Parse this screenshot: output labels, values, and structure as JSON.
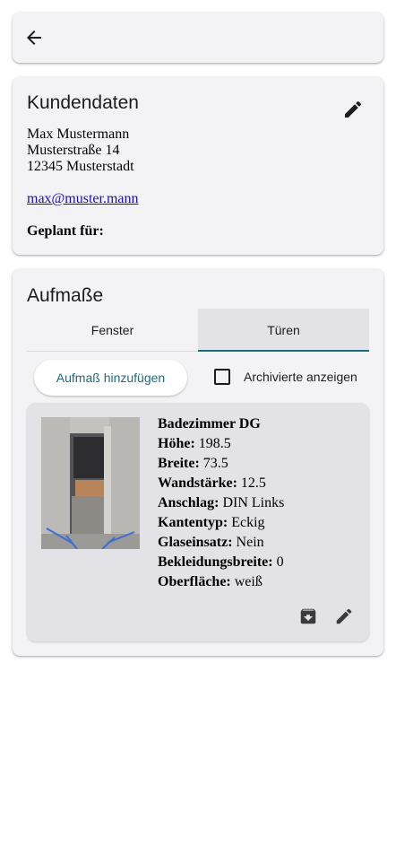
{
  "customer": {
    "title": "Kundendaten",
    "name": "Max Mustermann",
    "street": "Musterstraße 14",
    "city": "12345 Musterstadt",
    "email": "max@muster.mann",
    "planned_label": "Geplant für:"
  },
  "measures": {
    "title": "Aufmaße",
    "tabs": [
      {
        "label": "Fenster",
        "active": false
      },
      {
        "label": "Türen",
        "active": true
      }
    ],
    "add_button": "Aufmaß hinzufügen",
    "show_archived_label": "Archivierte anzeigen",
    "show_archived_checked": false,
    "items": [
      {
        "title": "Badezimmer DG",
        "fields": [
          {
            "label": "Höhe:",
            "value": "198.5"
          },
          {
            "label": "Breite:",
            "value": "73.5"
          },
          {
            "label": "Wandstärke:",
            "value": "12.5"
          },
          {
            "label": "Anschlag:",
            "value": "DIN Links"
          },
          {
            "label": "Kantentyp:",
            "value": "Eckig"
          },
          {
            "label": "Glaseinsatz:",
            "value": "Nein"
          },
          {
            "label": "Bekleidungsbreite:",
            "value": "0"
          },
          {
            "label": "Oberfläche:",
            "value": "weiß"
          }
        ]
      }
    ]
  },
  "icons": {
    "back": "arrow-left-icon",
    "edit": "pencil-icon",
    "archive": "archive-icon"
  },
  "colors": {
    "accent": "#1f6b7e",
    "card_bg": "#f3f3f5",
    "item_bg": "#e3e3e7",
    "link": "#1a0dab"
  }
}
